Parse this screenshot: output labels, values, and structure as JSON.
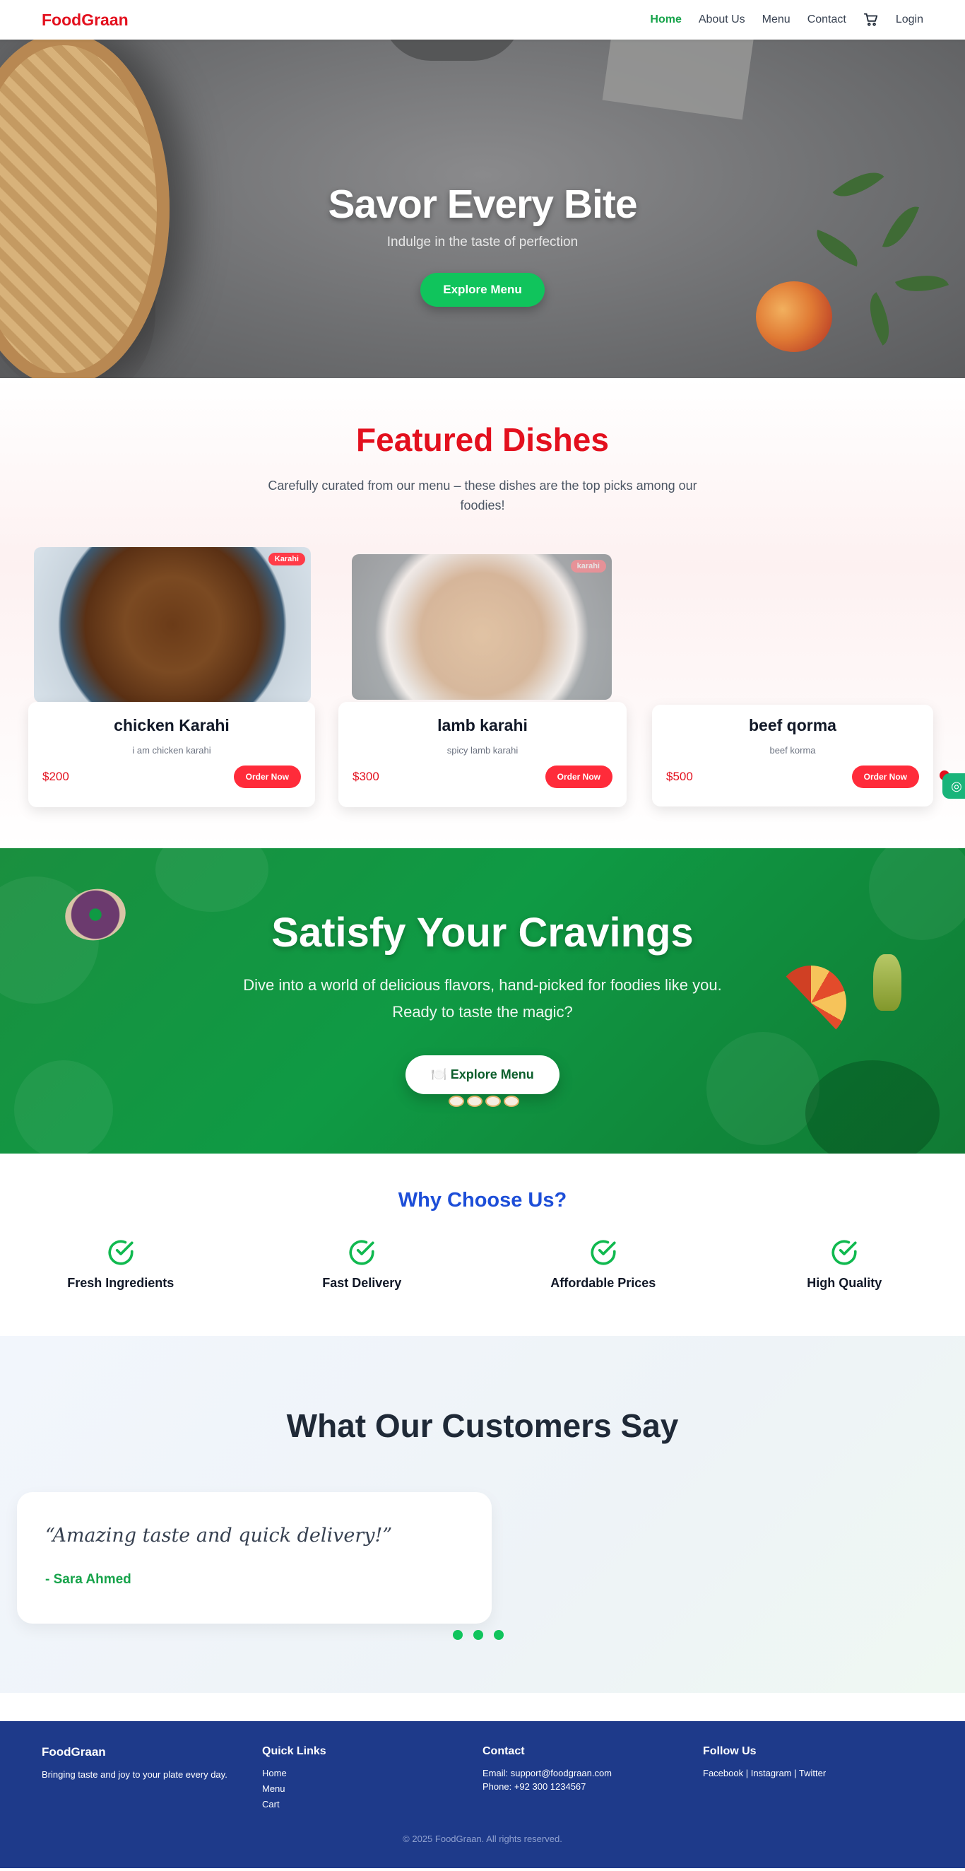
{
  "nav": {
    "brand": "FoodGraan",
    "links": [
      "Home",
      "About Us",
      "Menu",
      "Contact"
    ],
    "login": "Login"
  },
  "hero": {
    "title": "Savor Every Bite",
    "subtitle": "Indulge in the taste of perfection",
    "cta": "Explore Menu"
  },
  "featured": {
    "title": "Featured Dishes",
    "subtitle": "Carefully curated from our menu – these dishes are the top picks among our foodies!",
    "dishes": [
      {
        "name": "chicken Karahi",
        "desc": "i am chicken karahi",
        "price": "$200",
        "badge": "Karahi",
        "order": "Order Now"
      },
      {
        "name": "lamb karahi",
        "desc": "spicy lamb karahi",
        "price": "$300",
        "badge": "karahi",
        "order": "Order Now"
      },
      {
        "name": "beef qorma",
        "desc": "beef korma",
        "price": "$500",
        "order": "Order Now"
      }
    ]
  },
  "cravings": {
    "title": "Satisfy Your Cravings",
    "subtitle": "Dive into a world of delicious flavors, hand-picked for foodies like you. Ready to taste the magic?",
    "cta": "🍽️ Explore Menu"
  },
  "why": {
    "title": "Why Choose Us?",
    "items": [
      "Fresh Ingredients",
      "Fast Delivery",
      "Affordable Prices",
      "High Quality"
    ]
  },
  "testimonials": {
    "title": "What Our Customers Say",
    "quote": "“Amazing taste and quick delivery!”",
    "author": "- Sara Ahmed"
  },
  "footer": {
    "brand": "FoodGraan",
    "tagline": "Bringing taste and joy to your plate every day.",
    "quick_links_title": "Quick Links",
    "quick_links": [
      "Home",
      "Menu",
      "Cart"
    ],
    "contact_title": "Contact",
    "email": "Email: support@foodgraan.com",
    "phone": "Phone: +92 300 1234567",
    "follow_title": "Follow Us",
    "social": [
      "Facebook",
      "Instagram",
      "Twitter"
    ],
    "social_sep": " | ",
    "copyright": "© 2025 FoodGraan. All rights reserved."
  },
  "colors": {
    "brand_red": "#e3101e",
    "accent_green": "#10c45c",
    "footer_blue": "#1e3a8a",
    "why_title_blue": "#1d4ed8"
  },
  "icons": [
    "cart-icon",
    "check-circle-icon",
    "chat-widget-icon"
  ]
}
